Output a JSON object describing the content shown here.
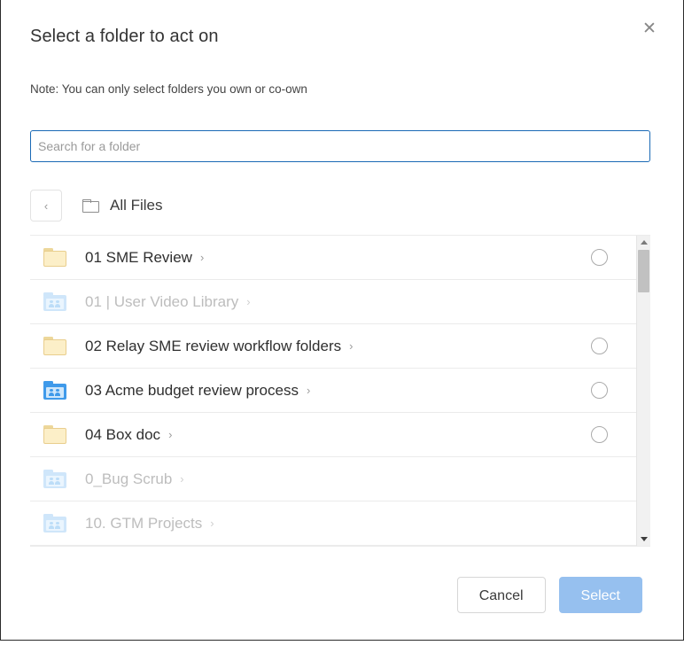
{
  "dialog": {
    "title": "Select a folder to act on",
    "note": "Note: You can only select folders you own or co-own",
    "close_label": "✕"
  },
  "search": {
    "value": "",
    "placeholder": "Search for a folder"
  },
  "breadcrumb": {
    "back_label": "‹",
    "folder_icon": "folder-outline-icon",
    "current": "All Files"
  },
  "list": {
    "rows": [
      {
        "name": "01 SME Review",
        "icon": "folder-icon",
        "chevron": "›",
        "disabled": false,
        "selectable": true,
        "selected": false
      },
      {
        "name": "01 | User Video Library",
        "icon": "shared-folder-icon",
        "chevron": "›",
        "disabled": true,
        "selectable": false,
        "selected": false
      },
      {
        "name": "02 Relay SME review workflow folders",
        "icon": "folder-icon",
        "chevron": "›",
        "disabled": false,
        "selectable": true,
        "selected": false
      },
      {
        "name": "03 Acme budget review process",
        "icon": "shared-folder-icon",
        "chevron": "›",
        "disabled": false,
        "selectable": true,
        "selected": false
      },
      {
        "name": "04 Box doc",
        "icon": "folder-icon",
        "chevron": "›",
        "disabled": false,
        "selectable": true,
        "selected": false
      },
      {
        "name": "0_Bug Scrub",
        "icon": "shared-folder-icon",
        "chevron": "›",
        "disabled": true,
        "selectable": false,
        "selected": false
      },
      {
        "name": "10. GTM Projects",
        "icon": "shared-folder-icon",
        "chevron": "›",
        "disabled": true,
        "selectable": false,
        "selected": false
      }
    ],
    "scrollbar": {
      "up_arrow": "scroll-up-arrow",
      "down_arrow": "scroll-down-arrow",
      "thumb_position_pct": 0
    }
  },
  "footer": {
    "cancel_label": "Cancel",
    "select_label": "Select",
    "select_enabled": false
  },
  "colors": {
    "focus_border": "#1a69b5",
    "primary_disabled": "#96c0ef",
    "folder_yellow": "#fcefc8",
    "folder_blue": "#3f9aea",
    "folder_blue_disabled": "#cfe6fa",
    "text": "#2f2f2f",
    "text_disabled": "#bdbdbd",
    "divider": "#ebebeb"
  }
}
